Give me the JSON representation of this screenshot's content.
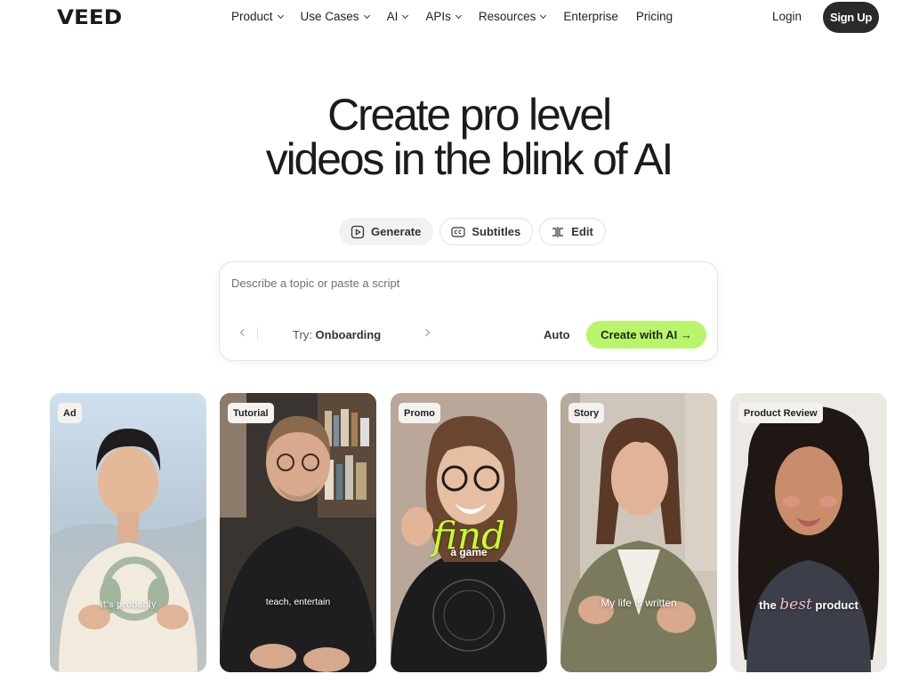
{
  "brand": {
    "logo": "VEED"
  },
  "nav": {
    "items": [
      {
        "label": "Product",
        "dropdown": true
      },
      {
        "label": "Use Cases",
        "dropdown": true
      },
      {
        "label": "AI",
        "dropdown": true
      },
      {
        "label": "APIs",
        "dropdown": true
      },
      {
        "label": "Resources",
        "dropdown": true
      },
      {
        "label": "Enterprise",
        "dropdown": false
      },
      {
        "label": "Pricing",
        "dropdown": false
      }
    ],
    "login": "Login",
    "signup": "Sign Up"
  },
  "hero": {
    "headline_line1": "Create pro level",
    "headline_line2": "videos in the blink of AI"
  },
  "modes": [
    {
      "label": "Generate",
      "icon": "play-square-icon",
      "active": true
    },
    {
      "label": "Subtitles",
      "icon": "cc-icon",
      "active": false
    },
    {
      "label": "Edit",
      "icon": "trim-icon",
      "active": false
    }
  ],
  "prompt": {
    "placeholder": "Describe a topic or paste a script",
    "try_prefix": "Try: ",
    "try_value": "Onboarding",
    "auto": "Auto",
    "create_label": "Create with AI →"
  },
  "cards": [
    {
      "tag": "Ad",
      "caption": "it's probably"
    },
    {
      "tag": "Tutorial",
      "caption": "teach, entertain"
    },
    {
      "tag": "Promo",
      "caption_script": "find",
      "caption": "a game"
    },
    {
      "tag": "Story",
      "caption": "My life is written"
    },
    {
      "tag": "Product Review",
      "caption_pre": "the",
      "caption_script": "best",
      "caption_post": "product"
    }
  ],
  "colors": {
    "accent": "#b8f56c",
    "dark": "#2a2a2a",
    "script_green": "#c6ff2e",
    "script_pink": "#f5b8c8"
  }
}
